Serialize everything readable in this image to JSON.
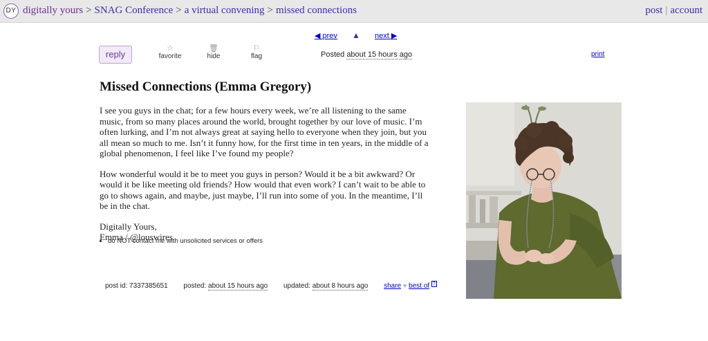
{
  "header": {
    "logo": "DY",
    "breadcrumbs": [
      "digitally yours",
      "SNAG Conference",
      "a virtual convening",
      "missed connections"
    ],
    "separator": ">",
    "post_link": "post",
    "divider": "|",
    "account_link": "account"
  },
  "nav": {
    "prev_label": "prev",
    "next_label": "next"
  },
  "actions": {
    "reply_label": "reply",
    "favorite_label": "favorite",
    "hide_label": "hide",
    "flag_label": "flag",
    "posted_prefix": "Posted",
    "posted_time": "about 15 hours ago",
    "print_label": "print"
  },
  "post": {
    "title": "Missed Connections (Emma Gregory)",
    "paragraphs": [
      "I see you guys in the chat; for a few hours every week, we’re all listening to the same music, from so many places around the world, brought together by our love of music. I’m often lurking, and I’m not always great at saying hello to everyone when they join, but you all mean so much to me. Isn’t it funny how, for the first time in ten years, in the middle of a global phenomenon, I feel like I’ve found my people?",
      "How wonderful would it be to meet you guys in person? Would it be a bit awkward? Or would it be like meeting old friends? How would that even work? I can’t wait to be able to go to shows again, and maybe, just maybe, I’ll run into some of you. In the meantime, I’ll be in the chat."
    ],
    "signoff_line1": "Digitally Yours,",
    "signoff_line2": "Emma / @louswires",
    "notice": "do NOT contact me with unsolicited services or offers"
  },
  "footer_meta": {
    "post_id": "post id: 7337385651",
    "posted_label": "posted:",
    "posted_time": "about 15 hours ago",
    "updated_label": "updated:",
    "updated_time": "about 8 hours ago",
    "share_label": "share",
    "best_of_label": "best of",
    "help_mark": "?"
  }
}
